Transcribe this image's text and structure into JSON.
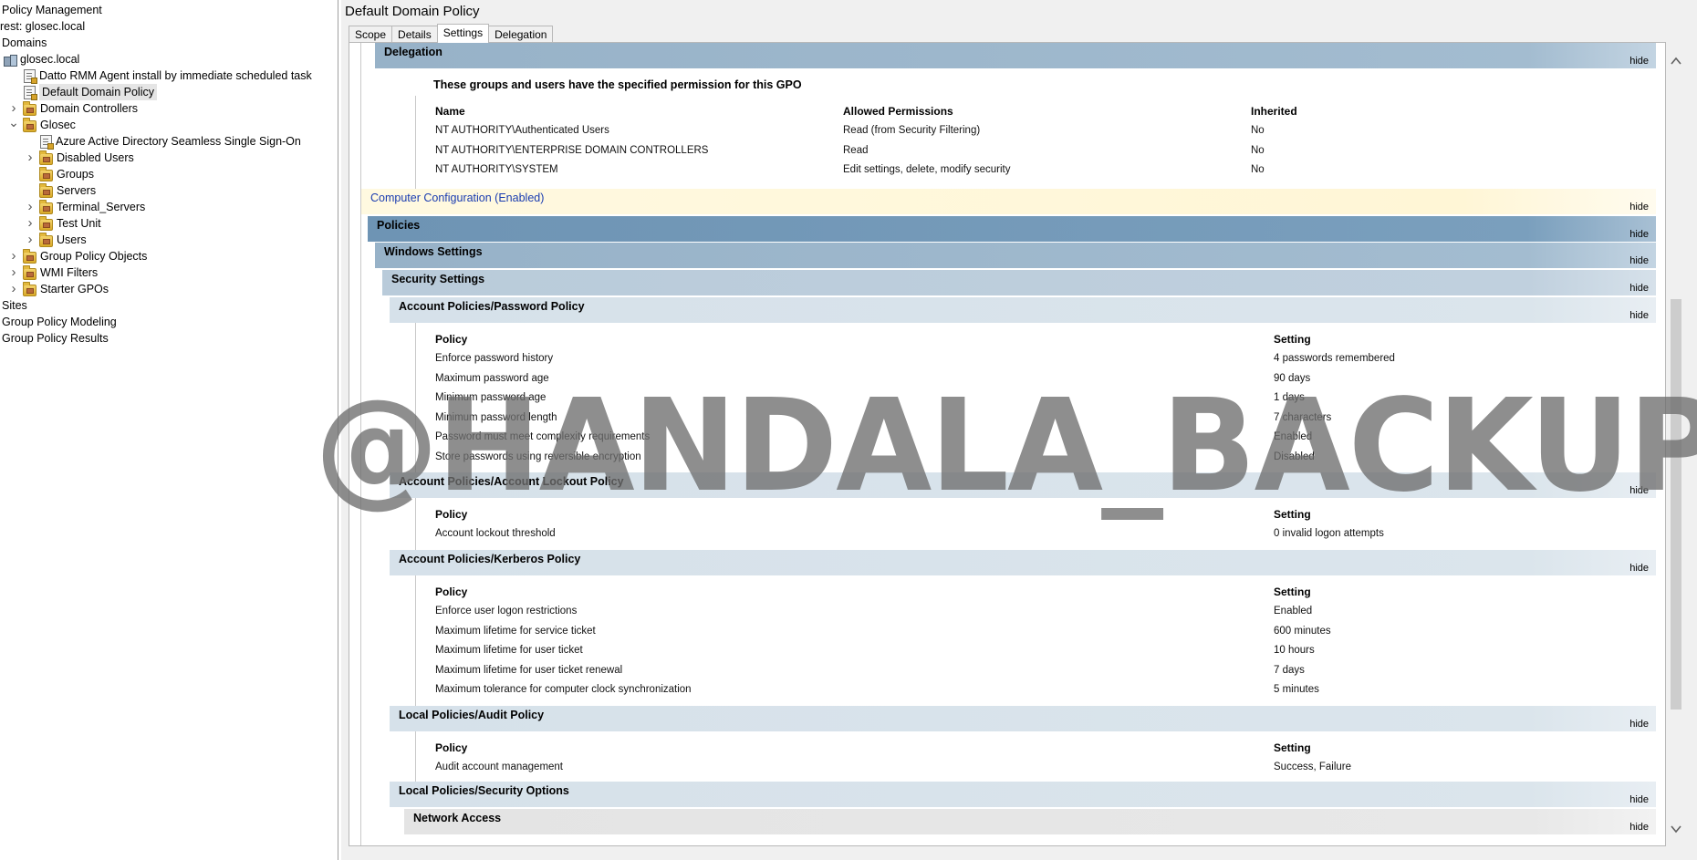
{
  "tree": {
    "items": [
      {
        "label": "Policy Management",
        "indent": 0,
        "icon": "none",
        "expander": "none"
      },
      {
        "label": "rest: glosec.local",
        "indent": 0,
        "icon": "none",
        "expander": "none"
      },
      {
        "label": "Domains",
        "indent": 0,
        "icon": "none",
        "expander": "none"
      },
      {
        "label": "glosec.local",
        "indent": 0,
        "icon": "domain-icon",
        "expander": "none"
      },
      {
        "label": "Datto RMM Agent install by immediate scheduled task",
        "indent": 1,
        "icon": "gpo-link-icon",
        "expander": "none"
      },
      {
        "label": "Default Domain Policy",
        "indent": 1,
        "icon": "gpo-link-icon",
        "expander": "none",
        "selected": true
      },
      {
        "label": "Domain Controllers",
        "indent": 1,
        "icon": "folder-icon",
        "expander": "collapsed"
      },
      {
        "label": "Glosec",
        "indent": 1,
        "icon": "folder-icon",
        "expander": "expanded"
      },
      {
        "label": "Azure Active Directory Seamless Single Sign-On",
        "indent": 2,
        "icon": "gpo-link-icon",
        "expander": "none"
      },
      {
        "label": "Disabled Users",
        "indent": 2,
        "icon": "folder-icon",
        "expander": "collapsed"
      },
      {
        "label": "Groups",
        "indent": 2,
        "icon": "folder-icon",
        "expander": "none"
      },
      {
        "label": "Servers",
        "indent": 2,
        "icon": "folder-icon",
        "expander": "none"
      },
      {
        "label": "Terminal_Servers",
        "indent": 2,
        "icon": "folder-icon",
        "expander": "collapsed"
      },
      {
        "label": "Test Unit",
        "indent": 2,
        "icon": "folder-icon",
        "expander": "collapsed"
      },
      {
        "label": "Users",
        "indent": 2,
        "icon": "folder-icon",
        "expander": "collapsed"
      },
      {
        "label": "Group Policy Objects",
        "indent": 1,
        "icon": "folder-icon",
        "expander": "collapsed"
      },
      {
        "label": "WMI Filters",
        "indent": 1,
        "icon": "folder-icon",
        "expander": "collapsed"
      },
      {
        "label": "Starter GPOs",
        "indent": 1,
        "icon": "folder-icon",
        "expander": "collapsed"
      },
      {
        "label": "Sites",
        "indent": 0,
        "icon": "none",
        "expander": "none"
      },
      {
        "label": "Group Policy Modeling",
        "indent": 0,
        "icon": "none",
        "expander": "none"
      },
      {
        "label": "Group Policy Results",
        "indent": 0,
        "icon": "none",
        "expander": "none"
      }
    ]
  },
  "pane": {
    "title": "Default Domain Policy",
    "tabs": [
      {
        "label": "Scope",
        "active": false
      },
      {
        "label": "Details",
        "active": false
      },
      {
        "label": "Settings",
        "active": true
      },
      {
        "label": "Delegation",
        "active": false
      }
    ]
  },
  "report": {
    "hide_label": "hide",
    "delegation": {
      "heading": "Delegation",
      "subheading": "These groups and users have the specified permission for this GPO",
      "columns": [
        "Name",
        "Allowed Permissions",
        "Inherited"
      ],
      "rows": [
        [
          "NT AUTHORITY\\Authenticated Users",
          "Read (from Security Filtering)",
          "No"
        ],
        [
          "NT AUTHORITY\\ENTERPRISE DOMAIN CONTROLLERS",
          "Read",
          "No"
        ],
        [
          "NT AUTHORITY\\SYSTEM",
          "Edit settings, delete, modify security",
          "No"
        ]
      ]
    },
    "computer_configuration": "Computer Configuration (Enabled)",
    "policies": "Policies",
    "windows_settings": "Windows Settings",
    "security_settings": "Security Settings",
    "columns": [
      "Policy",
      "Setting"
    ],
    "sections": [
      {
        "heading": "Account Policies/Password Policy",
        "rows": [
          [
            "Enforce password history",
            "4 passwords remembered"
          ],
          [
            "Maximum password age",
            "90 days"
          ],
          [
            "Minimum password age",
            "1 days"
          ],
          [
            "Minimum password length",
            "7 characters"
          ],
          [
            "Password must meet complexity requirements",
            "Enabled"
          ],
          [
            "Store passwords using reversible encryption",
            "Disabled"
          ]
        ]
      },
      {
        "heading": "Account Policies/Account Lockout Policy",
        "rows": [
          [
            "Account lockout threshold",
            "0 invalid logon attempts"
          ]
        ]
      },
      {
        "heading": "Account Policies/Kerberos Policy",
        "rows": [
          [
            "Enforce user logon restrictions",
            "Enabled"
          ],
          [
            "Maximum lifetime for service ticket",
            "600 minutes"
          ],
          [
            "Maximum lifetime for user ticket",
            "10 hours"
          ],
          [
            "Maximum lifetime for user ticket renewal",
            "7 days"
          ],
          [
            "Maximum tolerance for computer clock synchronization",
            "5 minutes"
          ]
        ]
      },
      {
        "heading": "Local Policies/Audit Policy",
        "rows": [
          [
            "Audit account management",
            "Success, Failure"
          ]
        ]
      }
    ],
    "security_options": "Local Policies/Security Options",
    "network_access": "Network Access"
  },
  "watermark": "@HANDALA_BACKUP"
}
